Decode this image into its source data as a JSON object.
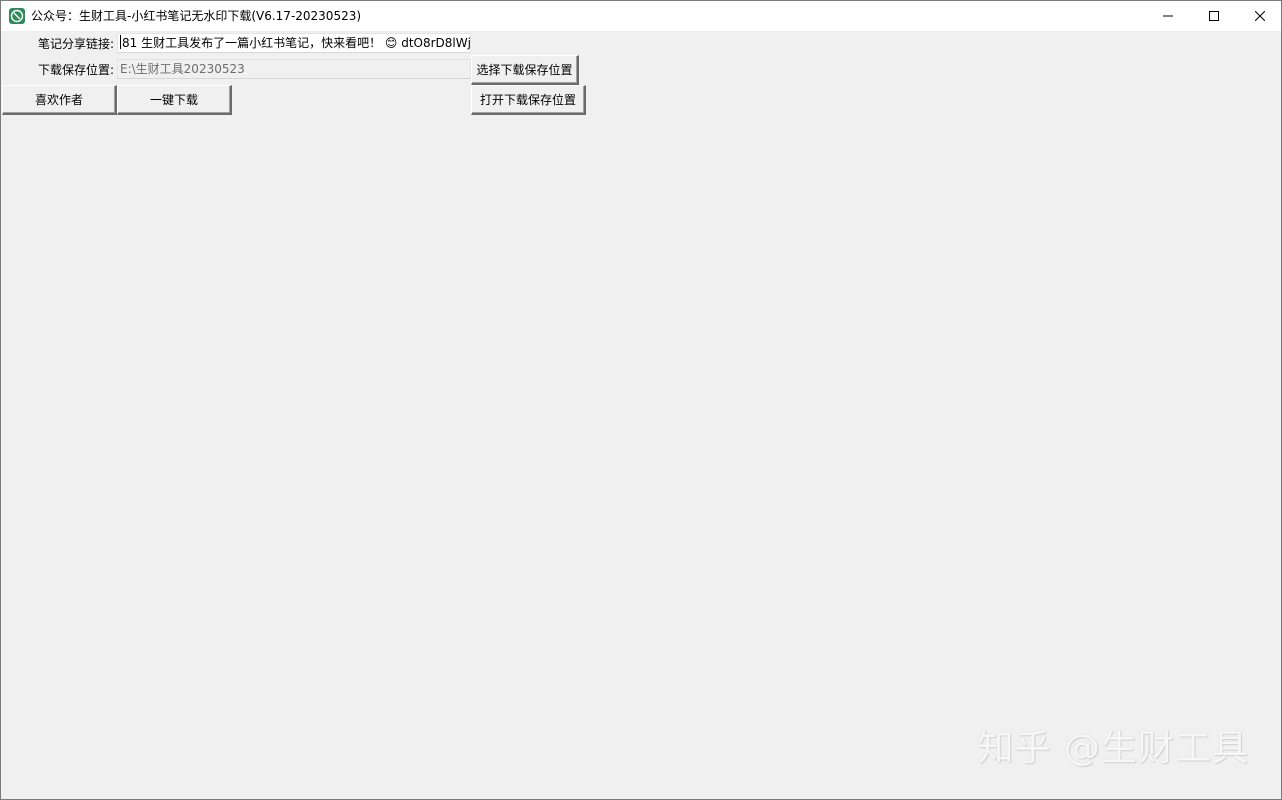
{
  "window": {
    "title": "公众号：生财工具-小红书笔记无水印下载(V6.17-20230523)",
    "icon": "app-logo-icon",
    "controls": [
      "minimize-icon",
      "maximize-icon",
      "close-icon"
    ]
  },
  "form": {
    "link_label": "笔记分享链接:",
    "link_value": "81 生财工具发布了一篇小红书笔记，快来看吧！ 😊 dtO8rD8lWj",
    "path_label": "下载保存位置:",
    "path_value": "E:\\生财工具20230523"
  },
  "buttons": {
    "choose_location": "选择下载保存位置",
    "like_author": "喜欢作者",
    "one_click_download": "一键下载",
    "open_location": "打开下载保存位置"
  },
  "watermark": {
    "text": "知乎 @生财工具"
  },
  "colors": {
    "window_bg": "#f0f0f0",
    "titlebar_bg": "#ffffff",
    "icon_green": "#2e8b57"
  }
}
